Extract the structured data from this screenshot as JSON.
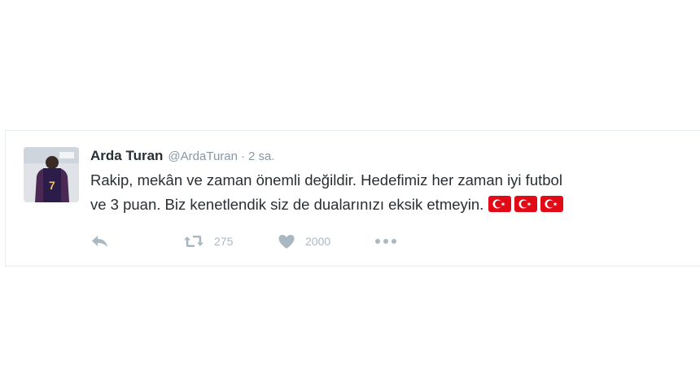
{
  "tweet": {
    "author_name": "Arda Turan",
    "handle": "@ArdaTuran",
    "separator": "·",
    "time": "2 sa.",
    "text_line_1": "Rakip, mekân ve zaman önemli değildir. Hedefimiz her zaman iyi futbol",
    "text_line_2": "ve 3 puan. Biz kenetlendik siz de dualarınızı eksik etmeyin.",
    "flags": [
      "turkey-flag-emoji",
      "turkey-flag-emoji",
      "turkey-flag-emoji"
    ],
    "retweet_count": "275",
    "like_count": "2000"
  },
  "icons": {
    "reply": "reply-icon",
    "retweet": "retweet-icon",
    "like": "heart-icon",
    "more": "more-dots-icon"
  },
  "colors": {
    "name": "#292f33",
    "muted": "#8899a6",
    "action": "#aab8c2",
    "flag_red": "#e30a17",
    "border": "#e6ecf0"
  }
}
